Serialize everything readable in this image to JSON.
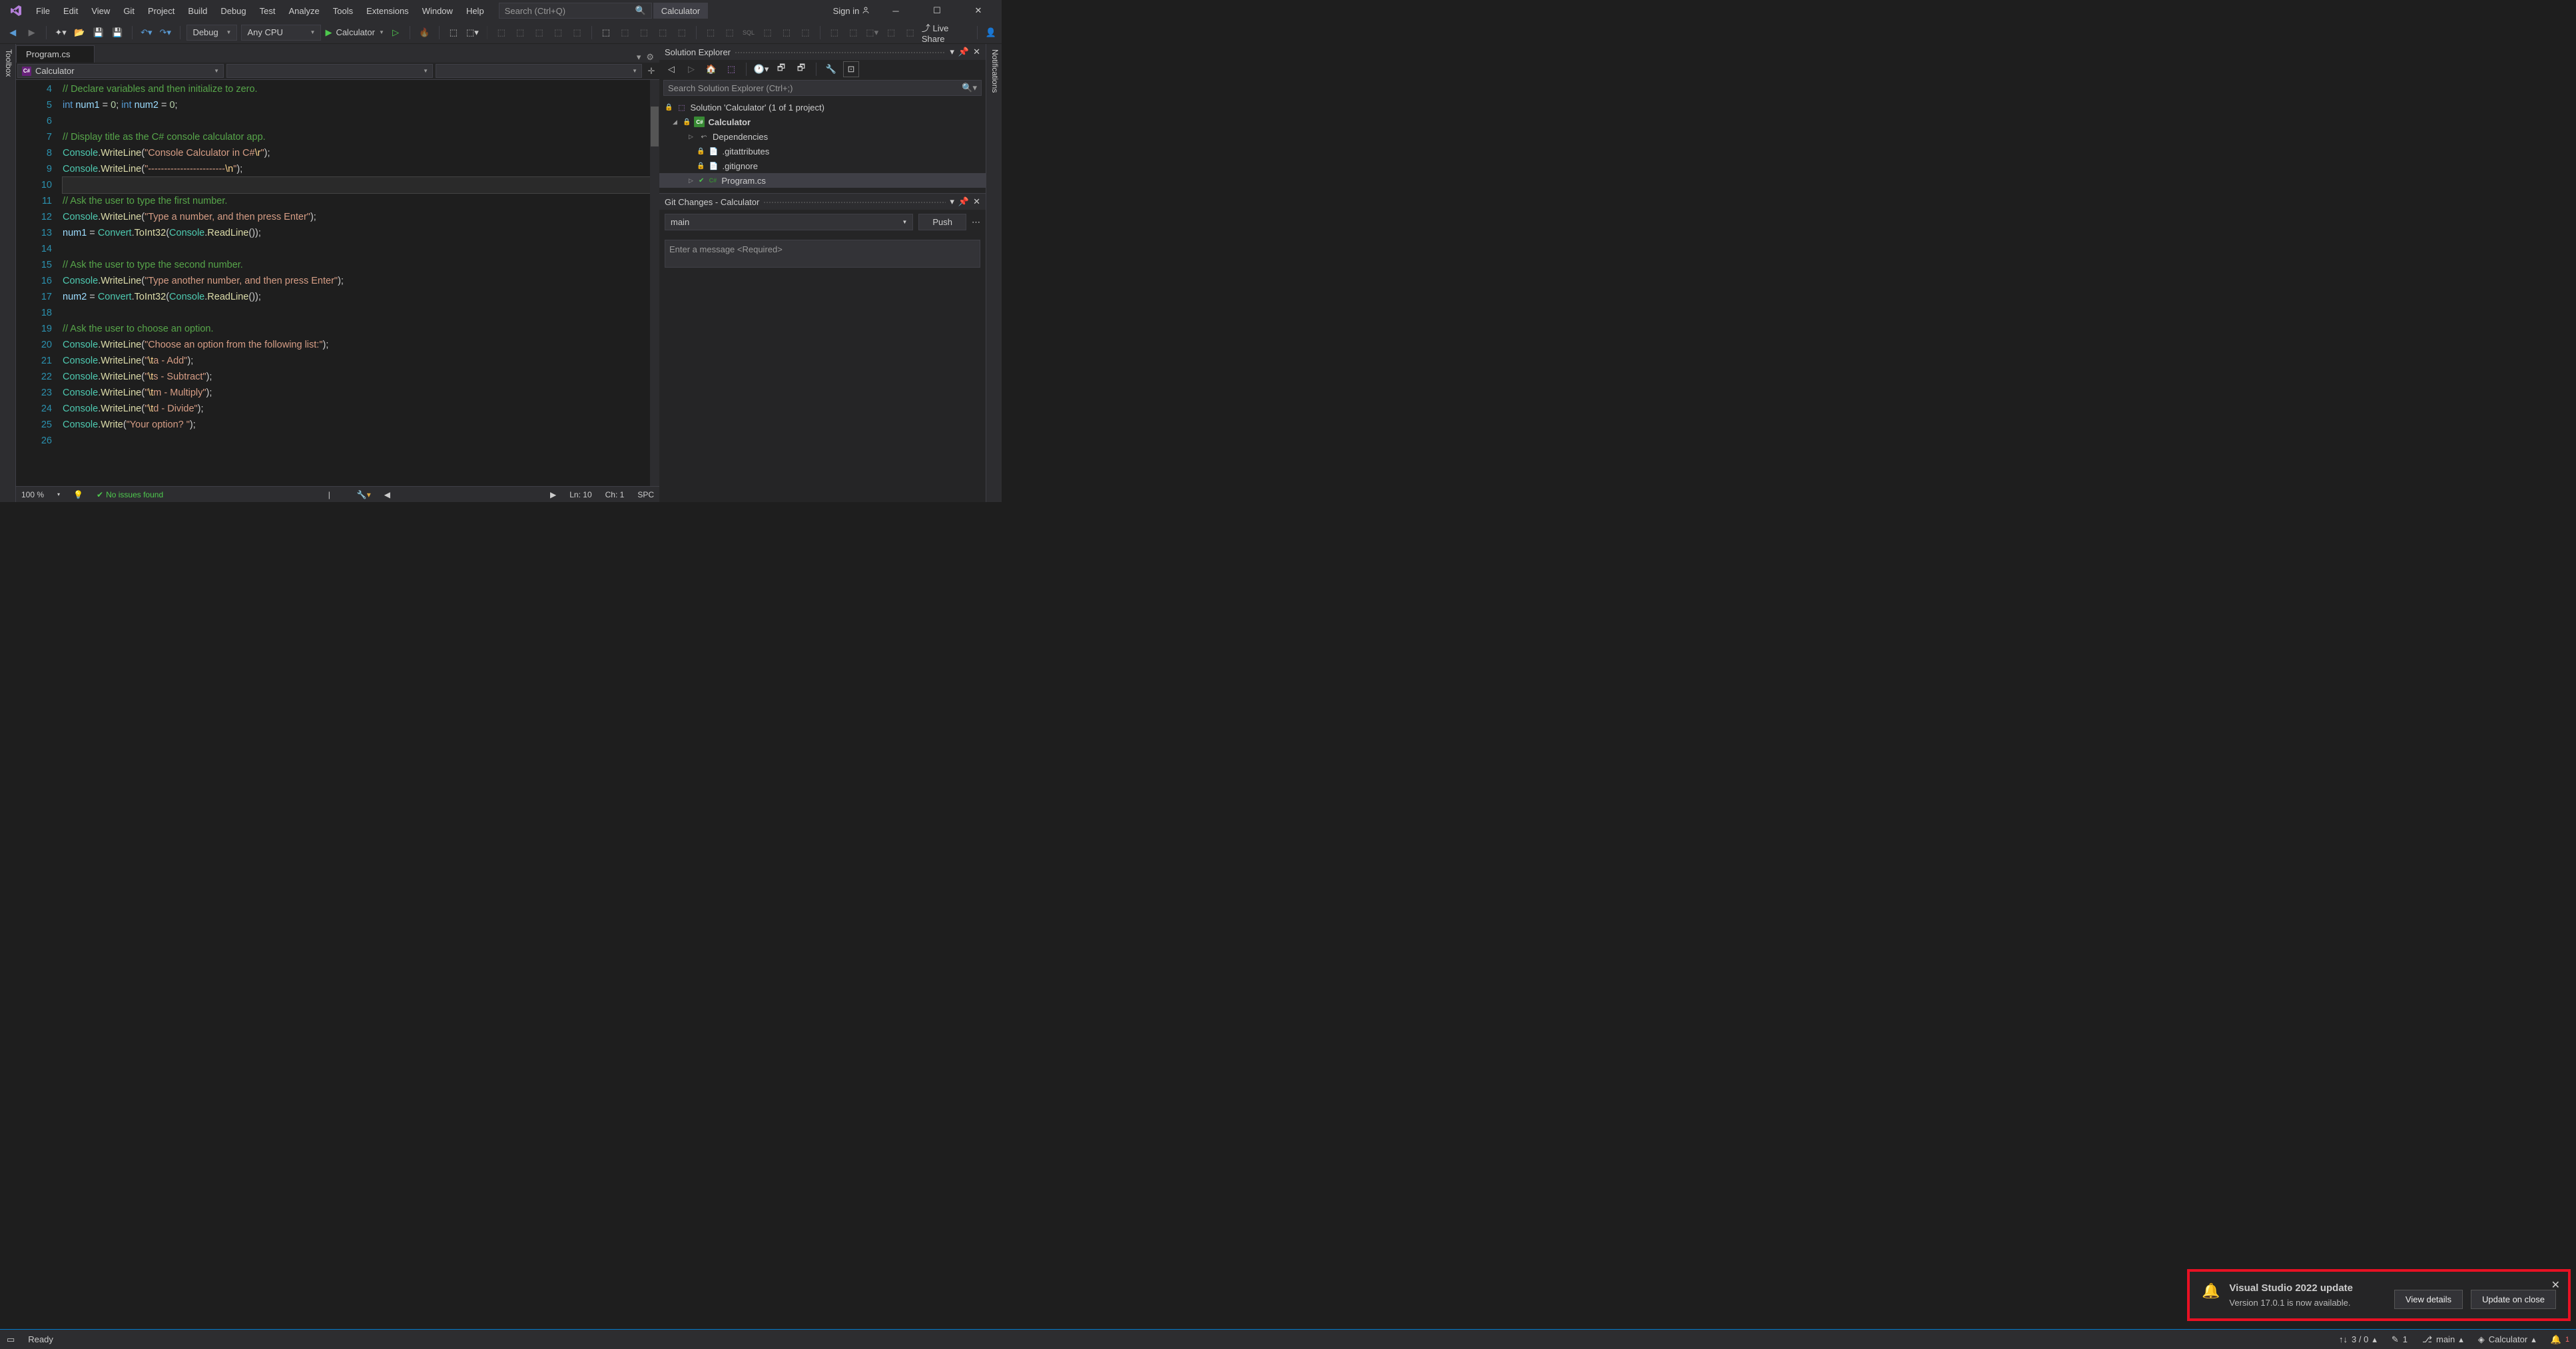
{
  "titlebar": {
    "menus": [
      "File",
      "Edit",
      "View",
      "Git",
      "Project",
      "Build",
      "Debug",
      "Test",
      "Analyze",
      "Tools",
      "Extensions",
      "Window",
      "Help"
    ],
    "search_placeholder": "Search (Ctrl+Q)",
    "app_title": "Calculator",
    "sign_in": "Sign in"
  },
  "toolbar": {
    "config": "Debug",
    "platform": "Any CPU",
    "start_target": "Calculator",
    "live_share": "Live Share"
  },
  "left_tool": "Toolbox",
  "right_tool": "Notifications",
  "editor": {
    "tab": "Program.cs",
    "nav_scope": "Calculator",
    "lines": [
      {
        "n": 4,
        "seg": [
          {
            "t": "// Declare variables and then initialize to zero.",
            "c": "c-comment"
          }
        ]
      },
      {
        "n": 5,
        "seg": [
          {
            "t": "int ",
            "c": "c-keyword"
          },
          {
            "t": "num1",
            "c": "c-var"
          },
          {
            "t": " = "
          },
          {
            "t": "0",
            "c": "c-num"
          },
          {
            "t": "; "
          },
          {
            "t": "int ",
            "c": "c-keyword"
          },
          {
            "t": "num2",
            "c": "c-var"
          },
          {
            "t": " = "
          },
          {
            "t": "0",
            "c": "c-num"
          },
          {
            "t": ";"
          }
        ]
      },
      {
        "n": 6,
        "seg": []
      },
      {
        "n": 7,
        "seg": [
          {
            "t": "// Display title as the C# console calculator app.",
            "c": "c-comment"
          }
        ]
      },
      {
        "n": 8,
        "seg": [
          {
            "t": "Console",
            "c": "c-type"
          },
          {
            "t": "."
          },
          {
            "t": "WriteLine",
            "c": "c-method"
          },
          {
            "t": "("
          },
          {
            "t": "\"Console Calculator in C#",
            "c": "c-string"
          },
          {
            "t": "\\r",
            "c": "c-escape"
          },
          {
            "t": "\"",
            "c": "c-string"
          },
          {
            "t": ");"
          }
        ]
      },
      {
        "n": 9,
        "seg": [
          {
            "t": "Console",
            "c": "c-type"
          },
          {
            "t": "."
          },
          {
            "t": "WriteLine",
            "c": "c-method"
          },
          {
            "t": "("
          },
          {
            "t": "\"------------------------",
            "c": "c-string"
          },
          {
            "t": "\\n",
            "c": "c-escape"
          },
          {
            "t": "\"",
            "c": "c-string"
          },
          {
            "t": ");"
          }
        ]
      },
      {
        "n": 10,
        "seg": [],
        "caret": true
      },
      {
        "n": 11,
        "seg": [
          {
            "t": "// Ask the user to type the first number.",
            "c": "c-comment"
          }
        ]
      },
      {
        "n": 12,
        "seg": [
          {
            "t": "Console",
            "c": "c-type"
          },
          {
            "t": "."
          },
          {
            "t": "WriteLine",
            "c": "c-method"
          },
          {
            "t": "("
          },
          {
            "t": "\"Type a number, and then press Enter\"",
            "c": "c-string"
          },
          {
            "t": ");"
          }
        ]
      },
      {
        "n": 13,
        "seg": [
          {
            "t": "num1",
            "c": "c-var"
          },
          {
            "t": " = "
          },
          {
            "t": "Convert",
            "c": "c-type"
          },
          {
            "t": "."
          },
          {
            "t": "ToInt32",
            "c": "c-method"
          },
          {
            "t": "("
          },
          {
            "t": "Console",
            "c": "c-type"
          },
          {
            "t": "."
          },
          {
            "t": "ReadLine",
            "c": "c-method"
          },
          {
            "t": "());"
          }
        ]
      },
      {
        "n": 14,
        "seg": []
      },
      {
        "n": 15,
        "seg": [
          {
            "t": "// Ask the user to type the second number.",
            "c": "c-comment"
          }
        ]
      },
      {
        "n": 16,
        "seg": [
          {
            "t": "Console",
            "c": "c-type"
          },
          {
            "t": "."
          },
          {
            "t": "WriteLine",
            "c": "c-method"
          },
          {
            "t": "("
          },
          {
            "t": "\"Type another number, and then press Enter\"",
            "c": "c-string"
          },
          {
            "t": ");"
          }
        ]
      },
      {
        "n": 17,
        "seg": [
          {
            "t": "num2",
            "c": "c-var"
          },
          {
            "t": " = "
          },
          {
            "t": "Convert",
            "c": "c-type"
          },
          {
            "t": "."
          },
          {
            "t": "ToInt32",
            "c": "c-method"
          },
          {
            "t": "("
          },
          {
            "t": "Console",
            "c": "c-type"
          },
          {
            "t": "."
          },
          {
            "t": "ReadLine",
            "c": "c-method"
          },
          {
            "t": "());"
          }
        ]
      },
      {
        "n": 18,
        "seg": []
      },
      {
        "n": 19,
        "seg": [
          {
            "t": "// Ask the user to choose an option.",
            "c": "c-comment"
          }
        ]
      },
      {
        "n": 20,
        "seg": [
          {
            "t": "Console",
            "c": "c-type"
          },
          {
            "t": "."
          },
          {
            "t": "WriteLine",
            "c": "c-method"
          },
          {
            "t": "("
          },
          {
            "t": "\"Choose an option from the following list:\"",
            "c": "c-string"
          },
          {
            "t": ");"
          }
        ]
      },
      {
        "n": 21,
        "seg": [
          {
            "t": "Console",
            "c": "c-type"
          },
          {
            "t": "."
          },
          {
            "t": "WriteLine",
            "c": "c-method"
          },
          {
            "t": "("
          },
          {
            "t": "\"",
            "c": "c-string"
          },
          {
            "t": "\\t",
            "c": "c-escape"
          },
          {
            "t": "a - Add\"",
            "c": "c-string"
          },
          {
            "t": ");"
          }
        ]
      },
      {
        "n": 22,
        "seg": [
          {
            "t": "Console",
            "c": "c-type"
          },
          {
            "t": "."
          },
          {
            "t": "WriteLine",
            "c": "c-method"
          },
          {
            "t": "("
          },
          {
            "t": "\"",
            "c": "c-string"
          },
          {
            "t": "\\t",
            "c": "c-escape"
          },
          {
            "t": "s - Subtract\"",
            "c": "c-string"
          },
          {
            "t": ");"
          }
        ]
      },
      {
        "n": 23,
        "seg": [
          {
            "t": "Console",
            "c": "c-type"
          },
          {
            "t": "."
          },
          {
            "t": "WriteLine",
            "c": "c-method"
          },
          {
            "t": "("
          },
          {
            "t": "\"",
            "c": "c-string"
          },
          {
            "t": "\\t",
            "c": "c-escape"
          },
          {
            "t": "m - Multiply\"",
            "c": "c-string"
          },
          {
            "t": ");"
          }
        ]
      },
      {
        "n": 24,
        "seg": [
          {
            "t": "Console",
            "c": "c-type"
          },
          {
            "t": "."
          },
          {
            "t": "WriteLine",
            "c": "c-method"
          },
          {
            "t": "("
          },
          {
            "t": "\"",
            "c": "c-string"
          },
          {
            "t": "\\t",
            "c": "c-escape"
          },
          {
            "t": "d - Divide\"",
            "c": "c-string"
          },
          {
            "t": ");"
          }
        ]
      },
      {
        "n": 25,
        "seg": [
          {
            "t": "Console",
            "c": "c-type"
          },
          {
            "t": "."
          },
          {
            "t": "Write",
            "c": "c-method"
          },
          {
            "t": "("
          },
          {
            "t": "\"Your option? \"",
            "c": "c-string"
          },
          {
            "t": ");"
          }
        ]
      },
      {
        "n": 26,
        "seg": []
      }
    ],
    "status": {
      "zoom": "100 %",
      "issues": "No issues found",
      "ln": "Ln: 10",
      "ch": "Ch: 1",
      "spc": "SPC"
    }
  },
  "solution": {
    "title": "Solution Explorer",
    "search_placeholder": "Search Solution Explorer (Ctrl+;)",
    "root": "Solution 'Calculator' (1 of 1 project)",
    "project": "Calculator",
    "deps": "Dependencies",
    "files": [
      ".gitattributes",
      ".gitignore",
      "Program.cs"
    ]
  },
  "git": {
    "title": "Git Changes - Calculator",
    "branch": "main",
    "push": "Push",
    "msg_placeholder": "Enter a message <Required>"
  },
  "toast": {
    "title": "Visual Studio 2022 update",
    "text": "Version 17.0.1 is now available.",
    "btn1": "View details",
    "btn2": "Update on close"
  },
  "statusbar": {
    "ready": "Ready",
    "sync": "3 / 0",
    "changes": "1",
    "branch": "main",
    "target": "Calculator",
    "notif_count": "1"
  }
}
